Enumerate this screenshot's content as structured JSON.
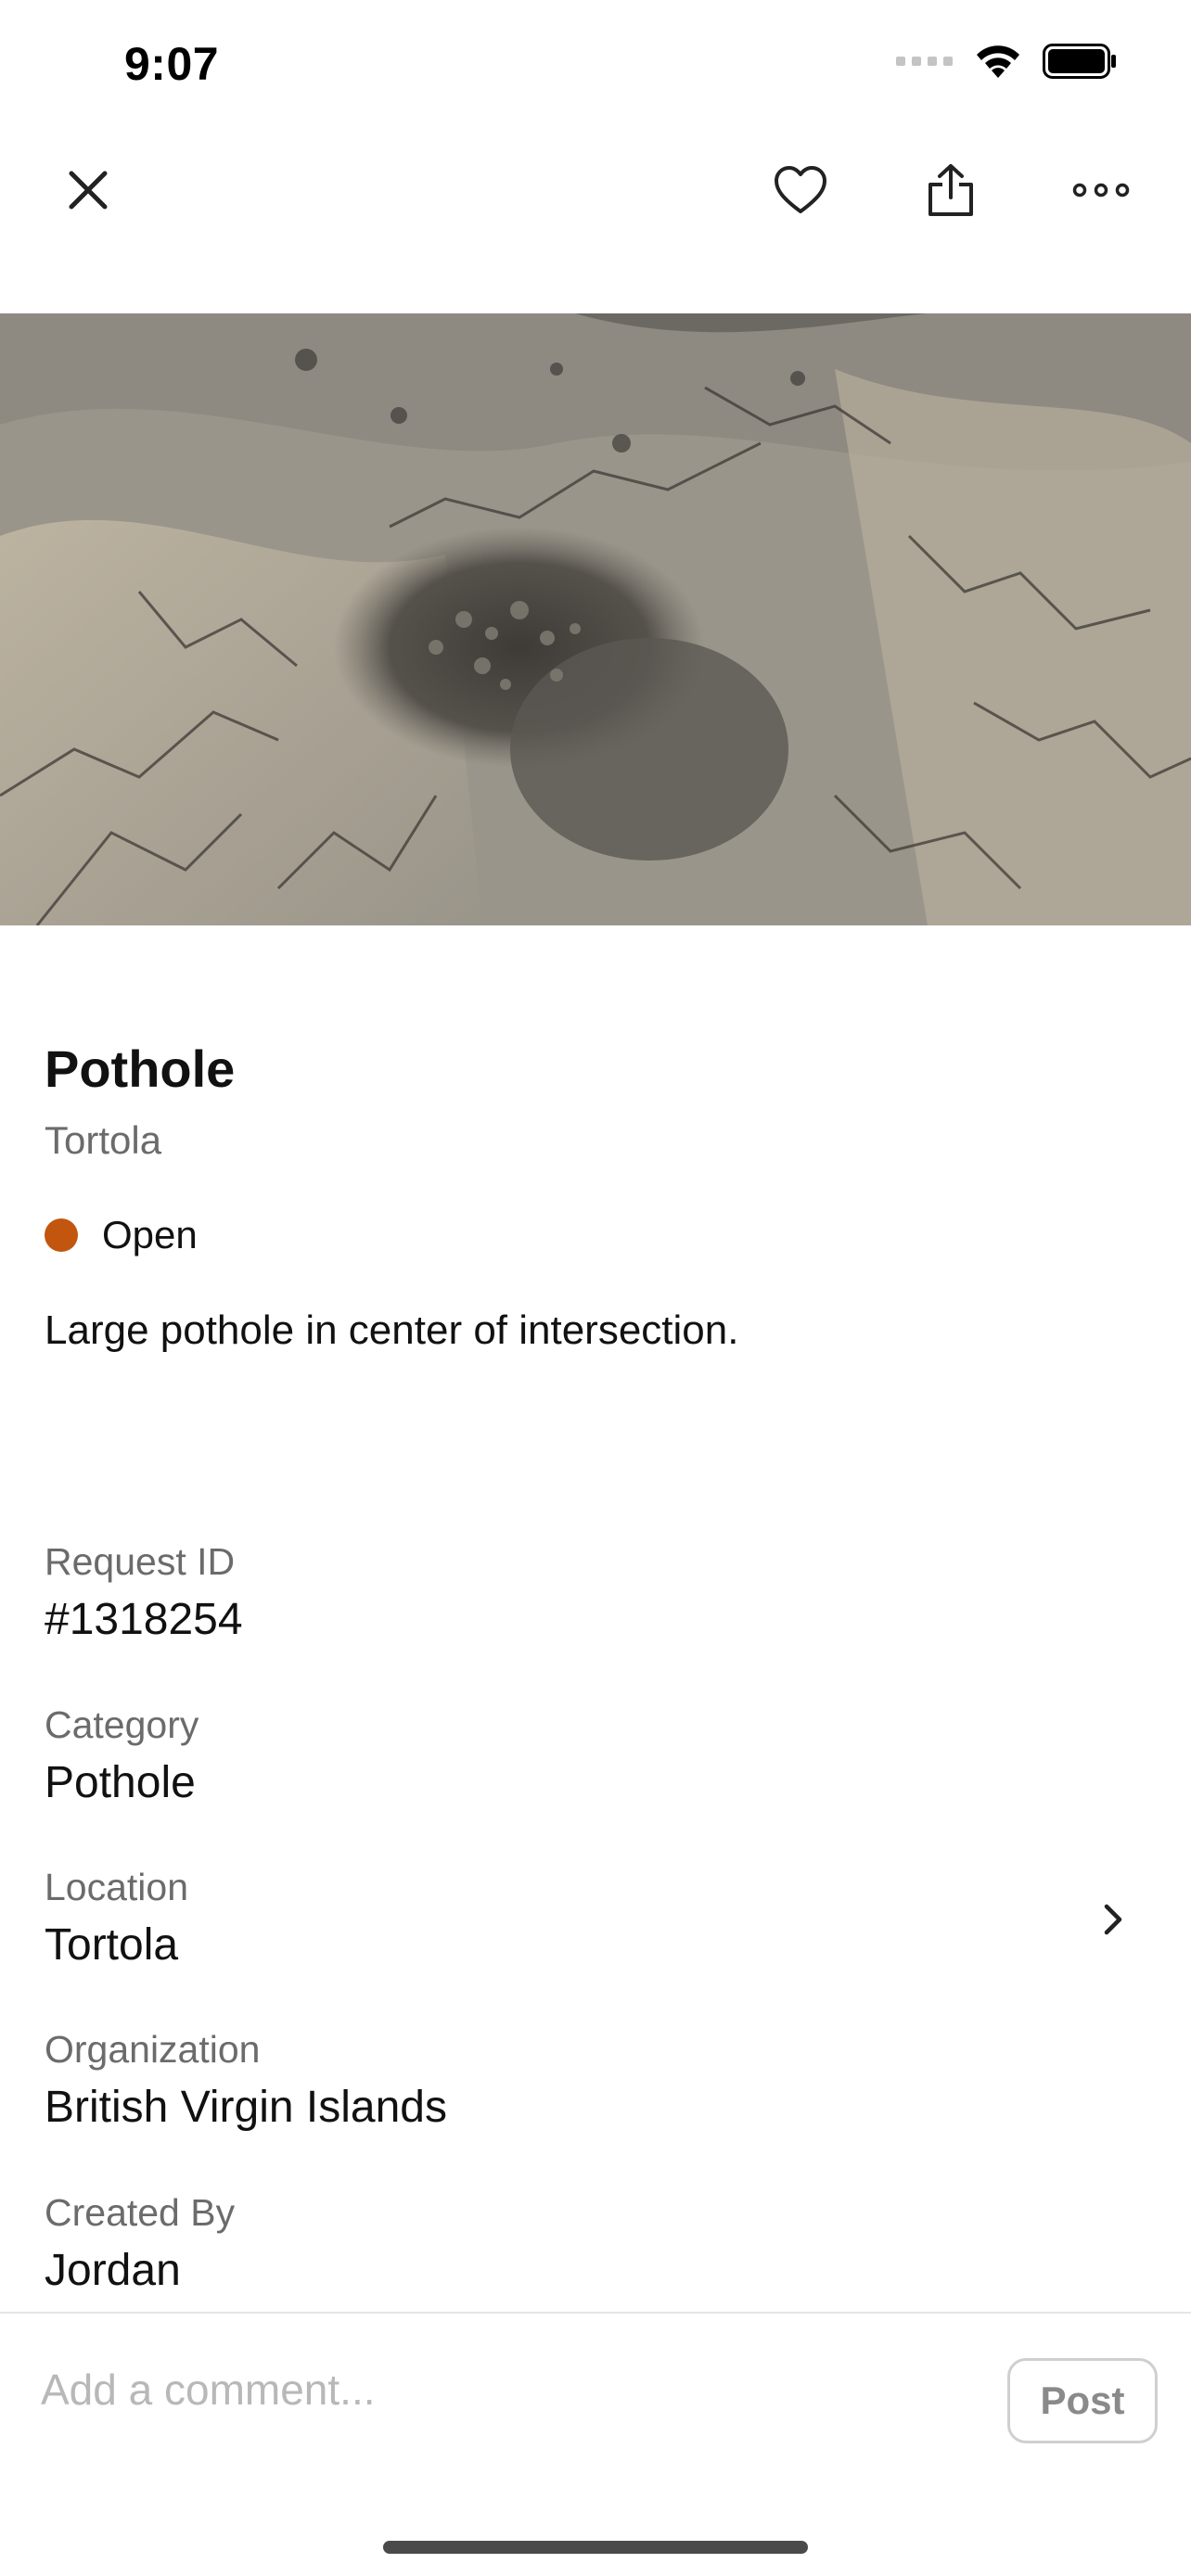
{
  "status_bar": {
    "time": "9:07",
    "icons": [
      "cellular-icon",
      "wifi-icon",
      "battery-icon"
    ]
  },
  "nav": {
    "icons": [
      "close-icon",
      "heart-icon",
      "share-icon",
      "more-icon"
    ]
  },
  "report": {
    "title": "Pothole",
    "subtitle": "Tortola",
    "status": "Open",
    "status_color": "#c2560f",
    "description": "Large pothole in center of intersection."
  },
  "fields": [
    {
      "label": "Request ID",
      "value": "#1318254"
    },
    {
      "label": "Category",
      "value": "Pothole"
    },
    {
      "label": "Location",
      "value": "Tortola"
    },
    {
      "label": "Organization",
      "value": "British Virgin Islands"
    },
    {
      "label": "Created By",
      "value": "Jordan"
    }
  ],
  "comment": {
    "placeholder": "Add a comment...",
    "value": "",
    "post_label": "Post"
  }
}
